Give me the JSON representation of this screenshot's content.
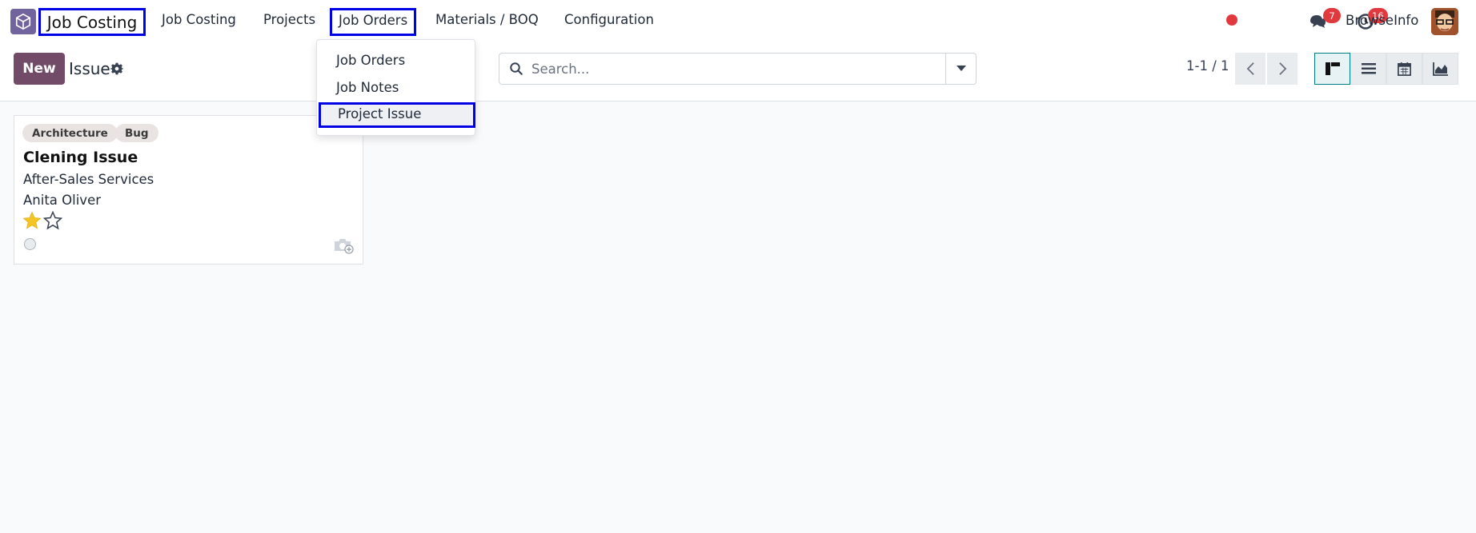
{
  "navbar": {
    "brand": "Job Costing",
    "menu": [
      "Job Costing",
      "Projects",
      "Job Orders",
      "Materials / BOQ",
      "Configuration"
    ],
    "messages_count": "7",
    "activities_count": "16",
    "company": "BrowseInfo"
  },
  "dropdown": {
    "items": [
      "Job Orders",
      "Job Notes",
      "Project Issue"
    ]
  },
  "control_panel": {
    "new_label": "New",
    "breadcrumb": "Issue",
    "search_placeholder": "Search...",
    "pager": "1-1 / 1"
  },
  "card": {
    "tags": [
      "Architecture",
      "Bug"
    ],
    "title": "Clening Issue",
    "project": "After-Sales Services",
    "assignee": "Anita Oliver",
    "priority_stars": 1,
    "priority_max": 2
  },
  "colors": {
    "brand_primary": "#714b67",
    "highlight_box": "#0000e6",
    "badge": "#e0393e",
    "active_view": "#017e84",
    "star_filled": "#f3c623"
  }
}
